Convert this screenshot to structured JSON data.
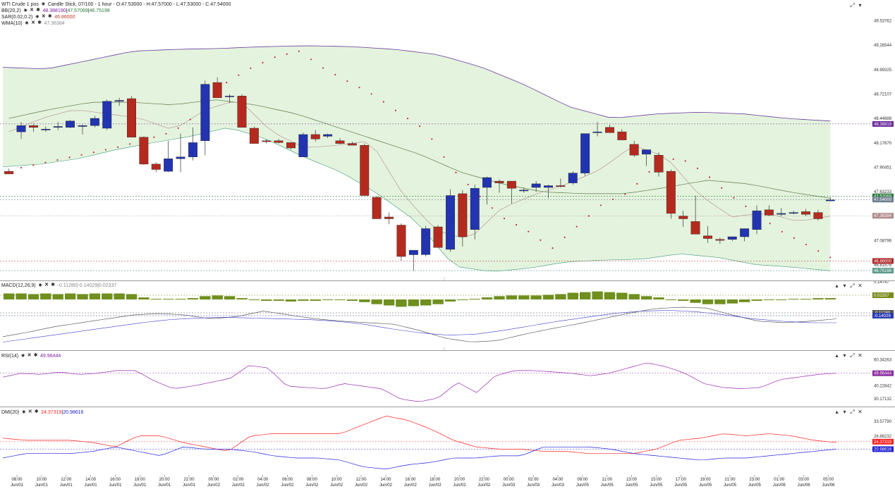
{
  "header": {
    "symbol": "WTI Crude 1",
    "pos": "pos",
    "description": "Candle Stick, 07/100 - 1 hour - O:47.53000 - H:47.57000 - L:47.53000 - C:47.54000"
  },
  "indicators": {
    "bb": {
      "label": "BB(20,2)",
      "values": [
        "48.388190",
        "47.57069",
        "46.75198"
      ]
    },
    "sar": {
      "label": "SAR(0.02,0.2)",
      "value": "46.86000"
    },
    "wma": {
      "label": "WMA(10)",
      "value": "47.36384"
    }
  },
  "price_axis": {
    "ticks": [
      "49.53762",
      "49.26544",
      "48.99325",
      "48.72107",
      "48.44888",
      "48.17670",
      "47.90451",
      "47.63233",
      "47.36014",
      "47.08796",
      "46.81578"
    ],
    "tags": [
      {
        "text": "48.38819",
        "value": 48.38819,
        "color": "#6a2a9a"
      },
      {
        "text": "47.57069",
        "value": 47.58,
        "color": "#2a7a3a"
      },
      {
        "text": "47.54000",
        "value": 47.545,
        "color": "#6d7f8f"
      },
      {
        "text": "47.36384",
        "value": 47.36384,
        "color": "#b08a8a"
      },
      {
        "text": "46.86000",
        "value": 46.86,
        "color": "#b02828"
      },
      {
        "text": "46.75198",
        "value": 46.75198,
        "color": "#5a9a8a"
      }
    ]
  },
  "macd": {
    "label": "MACD(12,26,9)",
    "values": "-0.11280|-0.14029|0.02337",
    "ticks": [
      "0.14747"
    ],
    "tags": [
      {
        "text": "0.02337",
        "color": "#7a8a1a"
      },
      {
        "text": "-0.11280",
        "color": "#555"
      },
      {
        "text": "-0.14029",
        "color": "#2a3ab0"
      }
    ]
  },
  "rsi": {
    "label": "RSI(14)",
    "value": "49.96444",
    "ticks": [
      "60.34263",
      "40.22842",
      "30.17132"
    ],
    "tag": "49.96444"
  },
  "dmi": {
    "label": "DMI(20)",
    "plus": "24.37319",
    "minus": "20.98616",
    "ticks": [
      "33.57790",
      "26.86232"
    ],
    "tags": [
      "24.37319",
      "20.98616"
    ]
  },
  "time_axis": [
    {
      "t": "08:00",
      "d": "Jun/01"
    },
    {
      "t": "10:00",
      "d": "Jun/01"
    },
    {
      "t": "12:00",
      "d": "Jun/01"
    },
    {
      "t": "14:00",
      "d": "Jun/01"
    },
    {
      "t": "16:00",
      "d": "Jun/01"
    },
    {
      "t": "18:00",
      "d": "Jun/01"
    },
    {
      "t": "20:00",
      "d": "Jun/01"
    },
    {
      "t": "22:00",
      "d": "Jun/01"
    },
    {
      "t": "00:00",
      "d": "Jun/02"
    },
    {
      "t": "02:00",
      "d": "Jun/02"
    },
    {
      "t": "04:00",
      "d": "Jun/02"
    },
    {
      "t": "06:00",
      "d": "Jun/02"
    },
    {
      "t": "08:00",
      "d": "Jun/02"
    },
    {
      "t": "10:00",
      "d": "Jun/02"
    },
    {
      "t": "12:00",
      "d": "Jun/02"
    },
    {
      "t": "14:00",
      "d": "Jun/02"
    },
    {
      "t": "16:00",
      "d": "Jun/02"
    },
    {
      "t": "18:00",
      "d": "Jun/02"
    },
    {
      "t": "20:00",
      "d": "Jun/02"
    },
    {
      "t": "22:00",
      "d": "Jun/02"
    },
    {
      "t": "00:00",
      "d": "Jun/03"
    },
    {
      "t": "02:00",
      "d": "Jun/03"
    },
    {
      "t": "04:00",
      "d": "Jun/03"
    },
    {
      "t": "09:00",
      "d": "Jun/05"
    },
    {
      "t": "11:00",
      "d": "Jun/05"
    },
    {
      "t": "13:00",
      "d": "Jun/05"
    },
    {
      "t": "15:00",
      "d": "Jun/05"
    },
    {
      "t": "17:00",
      "d": "Jun/05"
    },
    {
      "t": "19:00",
      "d": "Jun/05"
    },
    {
      "t": "21:00",
      "d": "Jun/05"
    },
    {
      "t": "23:00",
      "d": "Jun/05"
    },
    {
      "t": "01:00",
      "d": "Jun/06"
    },
    {
      "t": "03:00",
      "d": "Jun/06"
    },
    {
      "t": "05:00",
      "d": "Jun/06"
    }
  ],
  "chart_data": {
    "type": "candlestick",
    "price_range": [
      46.69,
      49.66
    ],
    "candles": [
      [
        47.86,
        47.89,
        47.83,
        47.83
      ],
      [
        48.3,
        48.41,
        48.22,
        48.37
      ],
      [
        48.37,
        48.39,
        48.3,
        48.35
      ],
      [
        48.33,
        48.36,
        48.3,
        48.33
      ],
      [
        48.35,
        48.41,
        48.32,
        48.36
      ],
      [
        48.35,
        48.43,
        48.34,
        48.42
      ],
      [
        48.36,
        48.38,
        48.27,
        48.37
      ],
      [
        48.37,
        48.48,
        48.35,
        48.45
      ],
      [
        48.34,
        48.66,
        48.32,
        48.64
      ],
      [
        48.64,
        48.68,
        48.59,
        48.65
      ],
      [
        48.67,
        48.7,
        48.24,
        48.24
      ],
      [
        48.24,
        48.25,
        47.93,
        47.94
      ],
      [
        47.94,
        47.96,
        47.85,
        47.88
      ],
      [
        47.86,
        48.2,
        47.85,
        48
      ],
      [
        48,
        48.28,
        47.85,
        48.02
      ],
      [
        48.02,
        48.35,
        47.98,
        48.18
      ],
      [
        48.2,
        48.87,
        48.04,
        48.83
      ],
      [
        48.85,
        48.91,
        48.68,
        48.68
      ],
      [
        48.7,
        48.72,
        48.62,
        48.7
      ],
      [
        48.7,
        48.72,
        48.43,
        48.35
      ],
      [
        48.34,
        48.36,
        48.17,
        48.17
      ],
      [
        48.2,
        48.22,
        48.17,
        48.19
      ],
      [
        48.2,
        48.22,
        48.17,
        48.18
      ],
      [
        48.18,
        48.18,
        48.1,
        48.12
      ],
      [
        48.02,
        48.29,
        48.02,
        48.27
      ],
      [
        48.27,
        48.32,
        48.19,
        48.22
      ],
      [
        48.25,
        48.28,
        48.23,
        48.27
      ],
      [
        48.2,
        48.23,
        48.16,
        48.17
      ],
      [
        48.17,
        48.19,
        48.15,
        48.15
      ],
      [
        48.15,
        48.17,
        47.6,
        47.59
      ],
      [
        47.57,
        47.58,
        47.37,
        47.33
      ],
      [
        47.35,
        47.4,
        47.27,
        47.33
      ],
      [
        47.26,
        47.28,
        46.86,
        46.91
      ],
      [
        46.93,
        46.96,
        46.75,
        46.98
      ],
      [
        46.93,
        47.25,
        46.91,
        47.22
      ],
      [
        47.24,
        47.26,
        47.02,
        47.01
      ],
      [
        46.99,
        47.66,
        46.96,
        47.59
      ],
      [
        47.61,
        47.65,
        47.02,
        47.13
      ],
      [
        47.21,
        47.71,
        47.1,
        47.67
      ],
      [
        47.68,
        47.8,
        47.49,
        47.79
      ],
      [
        47.75,
        47.77,
        47.62,
        47.73
      ],
      [
        47.75,
        47.72,
        47.5,
        47.67
      ],
      [
        47.65,
        47.68,
        47.62,
        47.65
      ],
      [
        47.68,
        47.75,
        47.63,
        47.72
      ],
      [
        47.68,
        47.71,
        47.56,
        47.7
      ],
      [
        47.7,
        47.78,
        47.68,
        47.69
      ],
      [
        47.73,
        47.86,
        47.71,
        47.84
      ],
      [
        47.84,
        48.14,
        47.81,
        48.28
      ],
      [
        48.29,
        48.41,
        48.25,
        48.3
      ],
      [
        48.35,
        48.38,
        48.29,
        48.29
      ],
      [
        48.3,
        48.33,
        48.21,
        48.21
      ],
      [
        48.16,
        48.2,
        48.02,
        48.04
      ],
      [
        48.05,
        48.1,
        47.92,
        48.1
      ],
      [
        48.04,
        48.07,
        47.8,
        47.85
      ],
      [
        47.86,
        47.88,
        47.33,
        47.39
      ],
      [
        47.36,
        47.42,
        47.24,
        47.33
      ],
      [
        47.3,
        47.59,
        47.18,
        47.16
      ],
      [
        47.14,
        47.25,
        47.06,
        47.11
      ],
      [
        47.1,
        47.12,
        47.05,
        47.09
      ],
      [
        47.1,
        47.12,
        47.08,
        47.13
      ],
      [
        47.13,
        47.17,
        47.08,
        47.22
      ],
      [
        47.21,
        47.48,
        47.16,
        47.42
      ],
      [
        47.43,
        47.48,
        47.36,
        47.37
      ],
      [
        47.38,
        47.45,
        47.36,
        47.39
      ],
      [
        47.39,
        47.42,
        47.38,
        47.4
      ],
      [
        47.41,
        47.44,
        47.36,
        47.38
      ],
      [
        47.4,
        47.43,
        47.31,
        47.33
      ],
      [
        47.53,
        47.57,
        47.53,
        47.54
      ]
    ],
    "down_color": "#b52a1e",
    "up_color": "#2234b0"
  }
}
